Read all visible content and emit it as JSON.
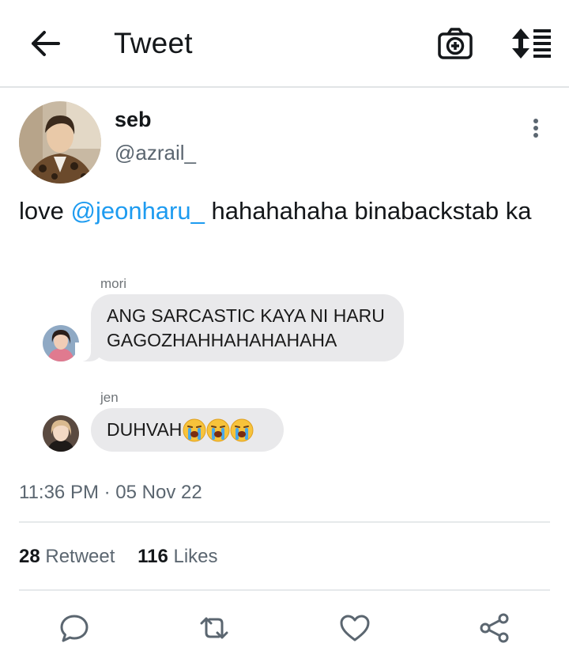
{
  "header": {
    "title": "Tweet",
    "icons": {
      "back": "arrow-left-icon",
      "camera": "camera-plus-icon",
      "sort": "sort-list-icon"
    }
  },
  "tweet": {
    "author_name": "seb",
    "author_handle": "@azrail_",
    "text_before": "love ",
    "mention": "@jeonharu_",
    "text_after": " hahahahaha binabackstab ka",
    "timestamp_time": "11:36 PM",
    "timestamp_sep": " · ",
    "timestamp_date": "05 Nov 22"
  },
  "messages": [
    {
      "sender": "mori",
      "text": "ANG SARCASTIC KAYA NI HARU GAGOZHAHHAHAHAHAHA"
    },
    {
      "sender": "jen",
      "text": "DUHVAH"
    }
  ],
  "stats": {
    "retweet_count": "28",
    "retweet_label": "Retweet",
    "likes_count": "116",
    "likes_label": "Likes"
  },
  "colors": {
    "accent": "#1d9bf0",
    "icon": "#5b6670",
    "bubble": "#e9e9eb"
  }
}
